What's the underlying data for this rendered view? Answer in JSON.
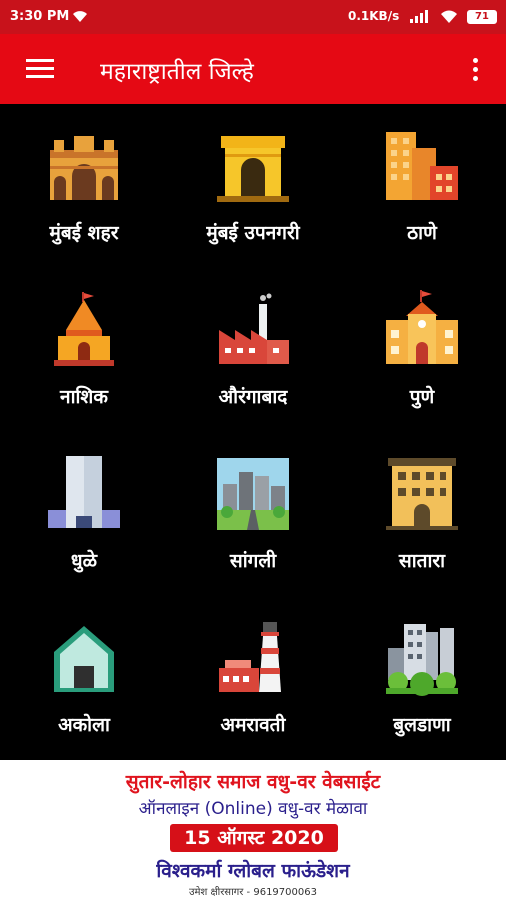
{
  "status_bar": {
    "time": "3:30 PM",
    "network_speed": "0.1KB/s",
    "battery": "71"
  },
  "app_bar": {
    "title": "महाराष्ट्रातील जिल्हे",
    "menu_icon": "hamburger-menu-icon",
    "overflow_icon": "more-vertical-icon"
  },
  "districts": [
    {
      "label": "मुंबई शहर",
      "icon": "gateway-building-icon"
    },
    {
      "label": "मुंबई उपनगरी",
      "icon": "india-gate-icon"
    },
    {
      "label": "ठाणे",
      "icon": "city-buildings-icon"
    },
    {
      "label": "नाशिक",
      "icon": "temple-icon"
    },
    {
      "label": "औरंगाबाद",
      "icon": "factory-icon"
    },
    {
      "label": "पुणे",
      "icon": "school-building-icon"
    },
    {
      "label": "धुळे",
      "icon": "tower-building-icon"
    },
    {
      "label": "सांगली",
      "icon": "city-road-icon"
    },
    {
      "label": "सातारा",
      "icon": "office-building-icon"
    },
    {
      "label": "अकोला",
      "icon": "house-icon"
    },
    {
      "label": "अमरावती",
      "icon": "lighthouse-icon"
    },
    {
      "label": "बुलडाणा",
      "icon": "city-park-icon"
    }
  ],
  "banner": {
    "line1": "सुतार-लोहार समाज वधु-वर वेबसाईट",
    "line2": "ऑनलाइन (Online) वधु-वर मेळावा",
    "date": "15 ऑगस्ट 2020",
    "org": "विश्वकर्मा ग्लोबल फाऊंडेशन",
    "contact": "उमेश क्षीरसागर - 9619700063"
  },
  "colors": {
    "status_bar": "#c8121b",
    "app_bar": "#e50914",
    "background": "#000000",
    "banner_red": "#e0141e",
    "banner_blue": "#2a1f8c"
  }
}
